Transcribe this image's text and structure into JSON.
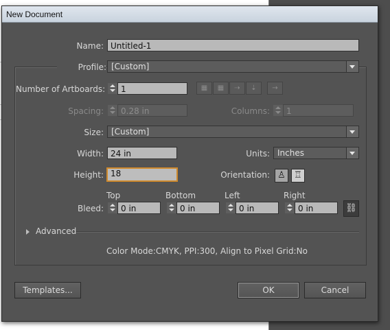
{
  "dialog": {
    "title": "New Document"
  },
  "name": {
    "label": "Name:",
    "value": "Untitled-1"
  },
  "profile": {
    "label": "Profile:",
    "value": "[Custom]"
  },
  "artboards": {
    "label": "Number of Artboards:",
    "value": "1",
    "layout_icons": [
      "grid-by-row-icon",
      "grid-by-column-icon",
      "arrange-by-row-icon",
      "arrange-by-column-icon",
      "right-to-left-icon"
    ]
  },
  "spacing": {
    "label": "Spacing:",
    "value": "0.28 in"
  },
  "columns": {
    "label": "Columns:",
    "value": "1"
  },
  "size": {
    "label": "Size:",
    "value": "[Custom]"
  },
  "width": {
    "label": "Width:",
    "value": "24 in"
  },
  "units": {
    "label": "Units:",
    "value": "Inches"
  },
  "height": {
    "label": "Height:",
    "value": "18"
  },
  "orientation": {
    "label": "Orientation:",
    "options": [
      "portrait-icon",
      "landscape-icon"
    ]
  },
  "bleed": {
    "label": "Bleed:",
    "top_label": "Top",
    "top": "0 in",
    "bottom_label": "Bottom",
    "bottom": "0 in",
    "left_label": "Left",
    "left": "0 in",
    "right_label": "Right",
    "right": "0 in",
    "link_icon": "chain-link-icon"
  },
  "advanced": {
    "label": "Advanced"
  },
  "summary": "Color Mode:CMYK, PPI:300, Align to Pixel Grid:No",
  "buttons": {
    "templates": "Templates...",
    "ok": "OK",
    "cancel": "Cancel"
  },
  "colors": {
    "dialog_bg": "#535353",
    "focus_border": "#d08a2c",
    "field_bg": "#b9b9b9"
  }
}
